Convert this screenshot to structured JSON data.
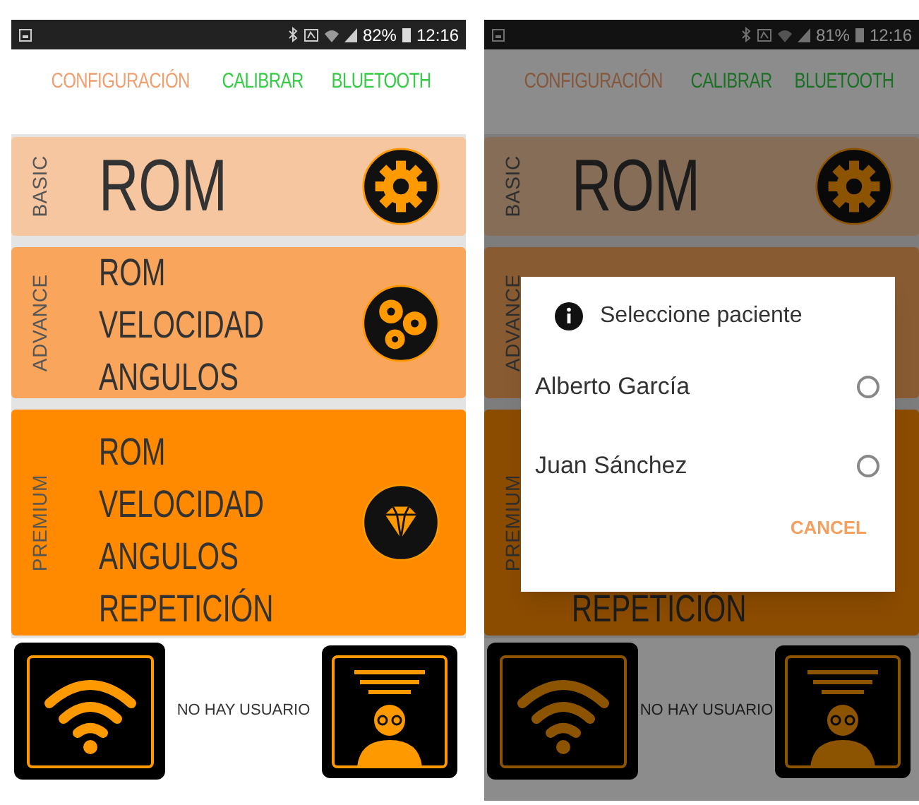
{
  "screens": [
    {
      "status_bar": {
        "battery": "82%",
        "time": "12:16"
      },
      "tabs": [
        {
          "label": "CONFIGURACIÓN",
          "selected": true
        },
        {
          "label": "CALIBRAR",
          "selected": false
        },
        {
          "label": "BLUETOOTH",
          "selected": false
        }
      ],
      "plans": [
        {
          "kind": "basic",
          "label": "BASIC",
          "features": [
            "ROM"
          ]
        },
        {
          "kind": "advance",
          "label": "ADVANCE",
          "features": [
            "ROM",
            "VELOCIDAD",
            "ANGULOS"
          ]
        },
        {
          "kind": "premium",
          "label": "PREMIUM",
          "features": [
            "ROM",
            "VELOCIDAD",
            "ANGULOS",
            "REPETICIÓN"
          ]
        }
      ],
      "footer": {
        "user_text": "NO HAY USUARIO"
      }
    },
    {
      "status_bar": {
        "battery": "81%",
        "time": "12:16"
      },
      "tabs": [
        {
          "label": "CONFIGURACIÓN",
          "selected": true
        },
        {
          "label": "CALIBRAR",
          "selected": false
        },
        {
          "label": "BLUETOOTH",
          "selected": false
        }
      ],
      "plans": [
        {
          "kind": "basic",
          "label": "BASIC",
          "features": [
            "ROM"
          ]
        },
        {
          "kind": "advance",
          "label": "ADVANCE"
        },
        {
          "kind": "premium",
          "label": "PREMIUM",
          "features": [
            "REPETICIÓN"
          ]
        }
      ],
      "footer": {
        "user_text": "NO HAY USUARIO"
      },
      "dialog": {
        "title": "Seleccione paciente",
        "options": [
          {
            "label": "Alberto García",
            "selected": false
          },
          {
            "label": "Juan Sánchez",
            "selected": false
          }
        ],
        "cancel": "CANCEL"
      }
    }
  ]
}
